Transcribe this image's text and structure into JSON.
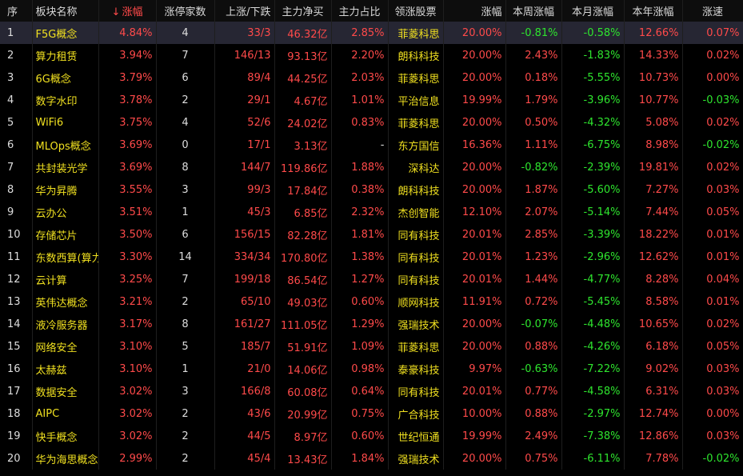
{
  "header": {
    "idx": "序",
    "name": "板块名称",
    "sort_arrow": "↓",
    "change": "涨幅",
    "limit_count": "涨停家数",
    "up_down": "上涨/下跌",
    "net_buy": "主力净买",
    "main_ratio": "主力占比",
    "lead_stock": "领涨股票",
    "lead_change": "涨幅",
    "week_change": "本周涨幅",
    "month_change": "本月涨幅",
    "year_change": "本年涨幅",
    "speed": "涨速"
  },
  "rows": [
    {
      "idx": "1",
      "name": "F5G概念",
      "change": "4.84%",
      "limit": "4",
      "updown": "33/3",
      "net": "46.32亿",
      "ratio": "2.85%",
      "stock": "菲菱科思",
      "schg": "20.00%",
      "week": "-0.81%",
      "month": "-0.58%",
      "year": "12.66%",
      "speed": "0.07%"
    },
    {
      "idx": "2",
      "name": "算力租赁",
      "change": "3.94%",
      "limit": "7",
      "updown": "146/13",
      "net": "93.13亿",
      "ratio": "2.20%",
      "stock": "朗科科技",
      "schg": "20.00%",
      "week": "2.43%",
      "month": "-1.83%",
      "year": "14.33%",
      "speed": "0.02%"
    },
    {
      "idx": "3",
      "name": "6G概念",
      "change": "3.79%",
      "limit": "6",
      "updown": "89/4",
      "net": "44.25亿",
      "ratio": "2.03%",
      "stock": "菲菱科思",
      "schg": "20.00%",
      "week": "0.18%",
      "month": "-5.55%",
      "year": "10.73%",
      "speed": "0.00%"
    },
    {
      "idx": "4",
      "name": "数字水印",
      "change": "3.78%",
      "limit": "2",
      "updown": "29/1",
      "net": "4.67亿",
      "ratio": "1.01%",
      "stock": "平治信息",
      "schg": "19.99%",
      "week": "1.79%",
      "month": "-3.96%",
      "year": "10.77%",
      "speed": "-0.03%"
    },
    {
      "idx": "5",
      "name": "WiFi6",
      "change": "3.75%",
      "limit": "4",
      "updown": "52/6",
      "net": "24.02亿",
      "ratio": "0.83%",
      "stock": "菲菱科思",
      "schg": "20.00%",
      "week": "0.50%",
      "month": "-4.32%",
      "year": "5.08%",
      "speed": "0.02%"
    },
    {
      "idx": "6",
      "name": "MLOps概念",
      "change": "3.69%",
      "limit": "0",
      "updown": "17/1",
      "net": "3.13亿",
      "ratio": "-",
      "stock": "东方国信",
      "schg": "16.36%",
      "week": "1.11%",
      "month": "-6.75%",
      "year": "8.98%",
      "speed": "-0.02%"
    },
    {
      "idx": "7",
      "name": "共封装光学",
      "change": "3.69%",
      "limit": "8",
      "updown": "144/7",
      "net": "119.86亿",
      "ratio": "1.88%",
      "stock": "深科达",
      "schg": "20.00%",
      "week": "-0.82%",
      "month": "-2.39%",
      "year": "19.81%",
      "speed": "0.02%"
    },
    {
      "idx": "8",
      "name": "华为昇腾",
      "change": "3.55%",
      "limit": "3",
      "updown": "99/3",
      "net": "17.84亿",
      "ratio": "0.38%",
      "stock": "朗科科技",
      "schg": "20.00%",
      "week": "1.87%",
      "month": "-5.60%",
      "year": "7.27%",
      "speed": "0.03%"
    },
    {
      "idx": "9",
      "name": "云办公",
      "change": "3.51%",
      "limit": "1",
      "updown": "45/3",
      "net": "6.85亿",
      "ratio": "2.32%",
      "stock": "杰创智能",
      "schg": "12.10%",
      "week": "2.07%",
      "month": "-5.14%",
      "year": "7.44%",
      "speed": "0.05%"
    },
    {
      "idx": "10",
      "name": "存储芯片",
      "change": "3.50%",
      "limit": "6",
      "updown": "156/15",
      "net": "82.28亿",
      "ratio": "1.81%",
      "stock": "同有科技",
      "schg": "20.01%",
      "week": "2.85%",
      "month": "-3.39%",
      "year": "18.22%",
      "speed": "0.01%"
    },
    {
      "idx": "11",
      "name": "东数西算(算力)",
      "change": "3.30%",
      "limit": "14",
      "updown": "334/34",
      "net": "170.80亿",
      "ratio": "1.38%",
      "stock": "同有科技",
      "schg": "20.01%",
      "week": "1.23%",
      "month": "-2.96%",
      "year": "12.62%",
      "speed": "0.01%"
    },
    {
      "idx": "12",
      "name": "云计算",
      "change": "3.25%",
      "limit": "7",
      "updown": "199/18",
      "net": "86.54亿",
      "ratio": "1.27%",
      "stock": "同有科技",
      "schg": "20.01%",
      "week": "1.44%",
      "month": "-4.77%",
      "year": "8.28%",
      "speed": "0.04%"
    },
    {
      "idx": "13",
      "name": "英伟达概念",
      "change": "3.21%",
      "limit": "2",
      "updown": "65/10",
      "net": "49.03亿",
      "ratio": "0.60%",
      "stock": "顺网科技",
      "schg": "11.91%",
      "week": "0.72%",
      "month": "-5.45%",
      "year": "8.58%",
      "speed": "0.01%"
    },
    {
      "idx": "14",
      "name": "液冷服务器",
      "change": "3.17%",
      "limit": "8",
      "updown": "161/27",
      "net": "111.05亿",
      "ratio": "1.29%",
      "stock": "强瑞技术",
      "schg": "20.00%",
      "week": "-0.07%",
      "month": "-4.48%",
      "year": "10.65%",
      "speed": "0.02%"
    },
    {
      "idx": "15",
      "name": "网络安全",
      "change": "3.10%",
      "limit": "5",
      "updown": "185/7",
      "net": "51.91亿",
      "ratio": "1.09%",
      "stock": "菲菱科思",
      "schg": "20.00%",
      "week": "0.88%",
      "month": "-4.26%",
      "year": "6.18%",
      "speed": "0.05%"
    },
    {
      "idx": "16",
      "name": "太赫兹",
      "change": "3.10%",
      "limit": "1",
      "updown": "21/0",
      "net": "14.06亿",
      "ratio": "0.98%",
      "stock": "泰豪科技",
      "schg": "9.97%",
      "week": "-0.63%",
      "month": "-7.22%",
      "year": "9.02%",
      "speed": "0.03%"
    },
    {
      "idx": "17",
      "name": "数据安全",
      "change": "3.02%",
      "limit": "3",
      "updown": "166/8",
      "net": "60.08亿",
      "ratio": "0.64%",
      "stock": "同有科技",
      "schg": "20.01%",
      "week": "0.77%",
      "month": "-4.58%",
      "year": "6.31%",
      "speed": "0.03%"
    },
    {
      "idx": "18",
      "name": "AIPC",
      "change": "3.02%",
      "limit": "2",
      "updown": "43/6",
      "net": "20.99亿",
      "ratio": "0.75%",
      "stock": "广合科技",
      "schg": "10.00%",
      "week": "0.88%",
      "month": "-2.97%",
      "year": "12.74%",
      "speed": "0.00%"
    },
    {
      "idx": "19",
      "name": "快手概念",
      "change": "3.02%",
      "limit": "2",
      "updown": "44/5",
      "net": "8.97亿",
      "ratio": "0.60%",
      "stock": "世纪恒通",
      "schg": "19.99%",
      "week": "2.49%",
      "month": "-7.38%",
      "year": "12.86%",
      "speed": "0.03%"
    },
    {
      "idx": "20",
      "name": "华为海思概念",
      "change": "2.99%",
      "limit": "2",
      "updown": "45/4",
      "net": "13.43亿",
      "ratio": "1.84%",
      "stock": "强瑞技术",
      "schg": "20.00%",
      "week": "0.75%",
      "month": "-6.11%",
      "year": "7.78%",
      "speed": "-0.02%"
    }
  ]
}
